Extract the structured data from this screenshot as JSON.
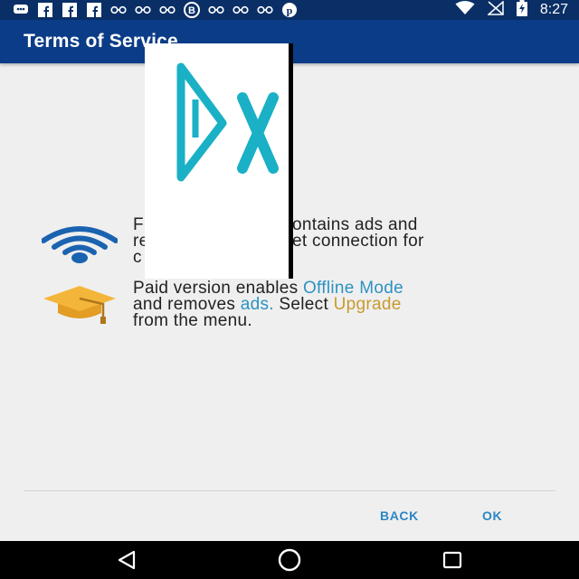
{
  "status_bar": {
    "time": "8:27",
    "notification_icons": [
      "chat-icon",
      "facebook-icon",
      "facebook-icon",
      "facebook-icon",
      "glasses-icon",
      "glasses-icon",
      "glasses-icon",
      "b-icon",
      "glasses-icon",
      "glasses-icon",
      "glasses-icon",
      "pinterest-icon"
    ],
    "system_icons": [
      "wifi-icon",
      "signal-icon",
      "battery-charging-icon"
    ]
  },
  "app_bar": {
    "title": "Terms of Service"
  },
  "rows": [
    {
      "icon": "wifi-icon",
      "lines": [
        "F",
        "ontains ads and",
        "re",
        "et connection for",
        "c"
      ]
    },
    {
      "icon": "graduation-cap-icon",
      "line1_pre": "Paid version enables ",
      "line1_link": "Offline Mode",
      "line2_pre": "and removes ",
      "line2_link": "ads.",
      "line2_mid": " Select ",
      "line2_link2": "Upgrade",
      "line3": "from the menu."
    }
  ],
  "overlay_ad": {
    "logo_text": "DX"
  },
  "buttons": {
    "back": "BACK",
    "ok": "OK"
  },
  "colors": {
    "primary": "#0b3c87",
    "accent": "#2d92c3",
    "gold": "#c99a2e",
    "background": "#efefef"
  },
  "nav_bar": {
    "back": "back-icon",
    "home": "home-icon",
    "recents": "recents-icon"
  }
}
